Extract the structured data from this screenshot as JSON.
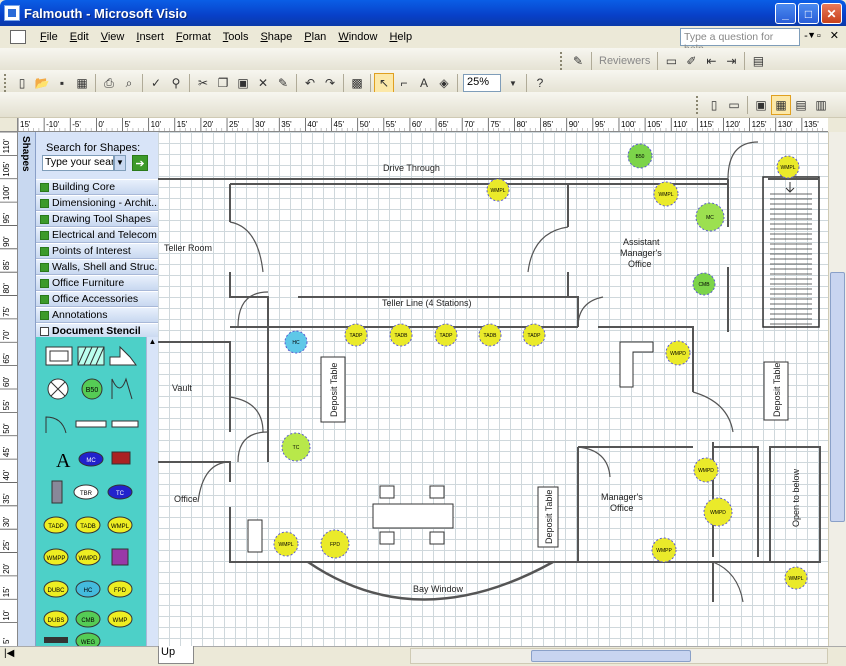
{
  "window": {
    "title": "Falmouth - Microsoft Visio"
  },
  "menu": {
    "items": [
      "File",
      "Edit",
      "View",
      "Insert",
      "Format",
      "Tools",
      "Shape",
      "Plan",
      "Window",
      "Help"
    ],
    "help_placeholder": "Type a question for help"
  },
  "toolbar": {
    "reviewers_label": "Reviewers",
    "zoom_value": "25%"
  },
  "shapes_pane": {
    "tab_label": "Shapes",
    "search_label": "Search for Shapes:",
    "search_placeholder": "Type your sear",
    "stencils": [
      "Building Core",
      "Dimensioning - Archit...",
      "Drawing Tool Shapes",
      "Electrical and Telecom",
      "Points of Interest",
      "Walls, Shell and Struc...",
      "Office Furniture",
      "Office Accessories",
      "Annotations",
      "Document Stencil"
    ],
    "stencil_shape_labels": [
      "B50",
      "MC",
      "TBR",
      "TC",
      "TADP",
      "TADB",
      "WMPL",
      "WMPP",
      "WMPD",
      "DUBC",
      "HC",
      "FPD",
      "DUBS",
      "CMB",
      "WMP",
      "WEG"
    ]
  },
  "rulers": {
    "horizontal": [
      "15'",
      "-10'",
      "-5'",
      "0'",
      "5'",
      "10'",
      "15'",
      "20'",
      "25'",
      "30'",
      "35'",
      "40'",
      "45'",
      "50'",
      "55'",
      "60'",
      "65'",
      "70'",
      "75'",
      "80'",
      "85'",
      "90'",
      "95'",
      "100'",
      "105'",
      "110'",
      "115'",
      "120'",
      "125'",
      "130'",
      "135'"
    ],
    "vertical": [
      "110'",
      "105'",
      "100'",
      "95'",
      "90'",
      "85'",
      "80'",
      "75'",
      "70'",
      "65'",
      "60'",
      "55'",
      "50'",
      "45'",
      "40'",
      "35'",
      "30'",
      "25'",
      "20'",
      "15'",
      "10'",
      "5'"
    ]
  },
  "floorplan": {
    "labels": {
      "drive_through": "Drive Through",
      "teller_room": "Teller Room",
      "assistant_office_1": "Assistant",
      "assistant_office_2": "Manager's",
      "assistant_office_3": "Office",
      "teller_line": "Teller Line (4 Stations)",
      "vault": "Vault",
      "deposit_table": "Deposit Table",
      "office": "Office",
      "managers_office_1": "Manager's",
      "managers_office_2": "Office",
      "bay_window": "Bay Window",
      "open_below": "Open to below"
    },
    "equipment_tags": [
      "B50",
      "WMPL",
      "WMPL",
      "MC",
      "CMB",
      "TADP",
      "TADB",
      "TADP",
      "TADB",
      "TADP",
      "HC",
      "WMPD",
      "WMPL",
      "WMPD",
      "TC",
      "WMPD",
      "WMPL",
      "FPD",
      "WMPP",
      "WMPL",
      "WMPL"
    ]
  },
  "page_tab": {
    "label": "Up"
  }
}
